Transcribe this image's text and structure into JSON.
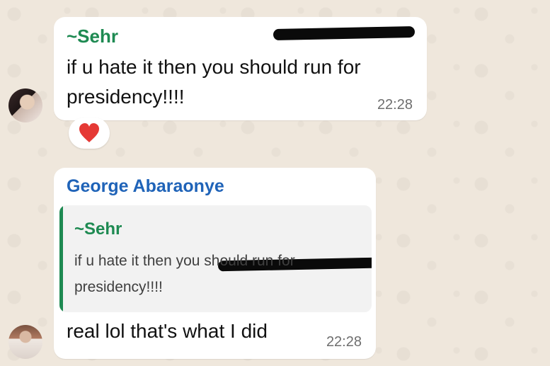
{
  "chat": {
    "message1": {
      "sender": "~Sehr",
      "text": "if u hate it then you should run for presidency!!!!",
      "time": "22:28",
      "reaction_icon": "heart-icon",
      "avatar_icon": "profile-photo-icon"
    },
    "message2": {
      "sender": "George Abaraonye",
      "quote": {
        "sender": "~Sehr",
        "text": "if u hate it then you should run for presidency!!!!"
      },
      "text": "real lol that's what I did",
      "time": "22:28",
      "avatar_icon": "profile-photo-icon"
    }
  },
  "colors": {
    "background": "#efe7dc",
    "bubble": "#ffffff",
    "sehr_name": "#1e8a52",
    "george_name": "#1f63b8",
    "quote_bar": "#1e8a52",
    "reaction_heart": "#e53935"
  }
}
